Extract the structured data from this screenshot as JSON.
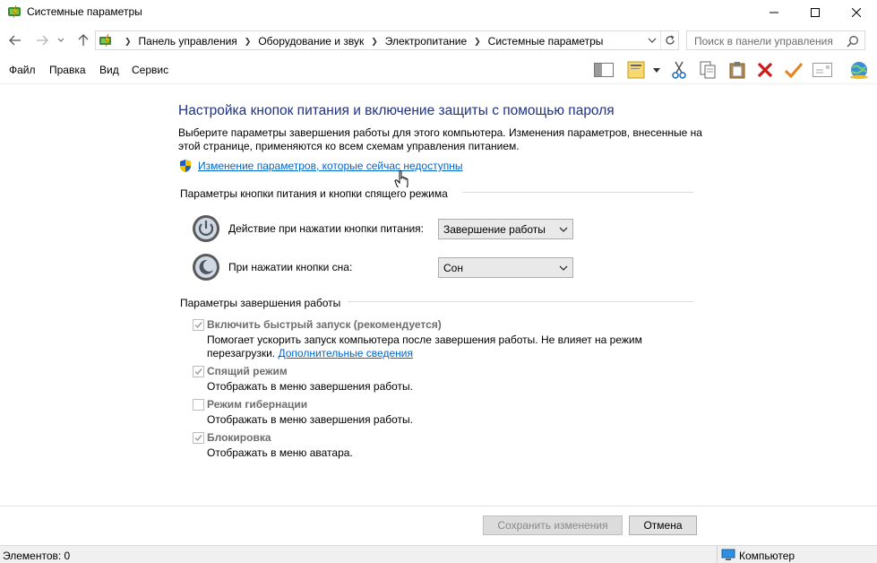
{
  "window": {
    "title": "Системные параметры",
    "app_icon": "power-options-icon"
  },
  "address": {
    "breadcrumbs": [
      "Панель управления",
      "Оборудование и звук",
      "Электропитание",
      "Системные параметры"
    ],
    "search_placeholder": "Поиск в панели управления"
  },
  "menu": {
    "items": [
      "Файл",
      "Правка",
      "Вид",
      "Сервис"
    ]
  },
  "toolbar": {
    "icons": [
      "layout-icon",
      "properties-icon",
      "cut-icon",
      "copy-icon",
      "paste-icon",
      "delete-icon",
      "checkmark-icon",
      "mail-icon",
      "globe-icon"
    ]
  },
  "content": {
    "heading": "Настройка кнопок питания и включение защиты с помощью пароля",
    "description": "Выберите параметры завершения работы для этого компьютера. Изменения параметров, внесенные на этой странице, применяются ко всем схемам управления питанием.",
    "change_link": "Изменение параметров, которые сейчас недоступны",
    "power_group": {
      "title": "Параметры кнопки питания и кнопки спящего режима",
      "power_button_label": "Действие при нажатии кнопки питания:",
      "power_button_value": "Завершение работы",
      "sleep_button_label": "При нажатии кнопки сна:",
      "sleep_button_value": "Сон"
    },
    "shutdown_group": {
      "title": "Параметры завершения работы",
      "items": [
        {
          "title": "Включить быстрый запуск (рекомендуется)",
          "desc": "Помогает ускорить запуск компьютера после завершения работы. Не влияет на режим перезагрузки.",
          "link": "Дополнительные сведения",
          "checked": true
        },
        {
          "title": "Спящий режим",
          "desc": "Отображать в меню завершения работы.",
          "checked": true
        },
        {
          "title": "Режим гибернации",
          "desc": "Отображать в меню завершения работы.",
          "checked": false
        },
        {
          "title": "Блокировка",
          "desc": "Отображать в меню аватара.",
          "checked": true
        }
      ]
    }
  },
  "buttons": {
    "save": "Сохранить изменения",
    "cancel": "Отмена"
  },
  "status": {
    "items_count": "Элементов: 0",
    "location": "Компьютер"
  },
  "colors": {
    "heading": "#1e3287",
    "link": "#0066cc",
    "disabled_text": "#6d6d6d"
  }
}
